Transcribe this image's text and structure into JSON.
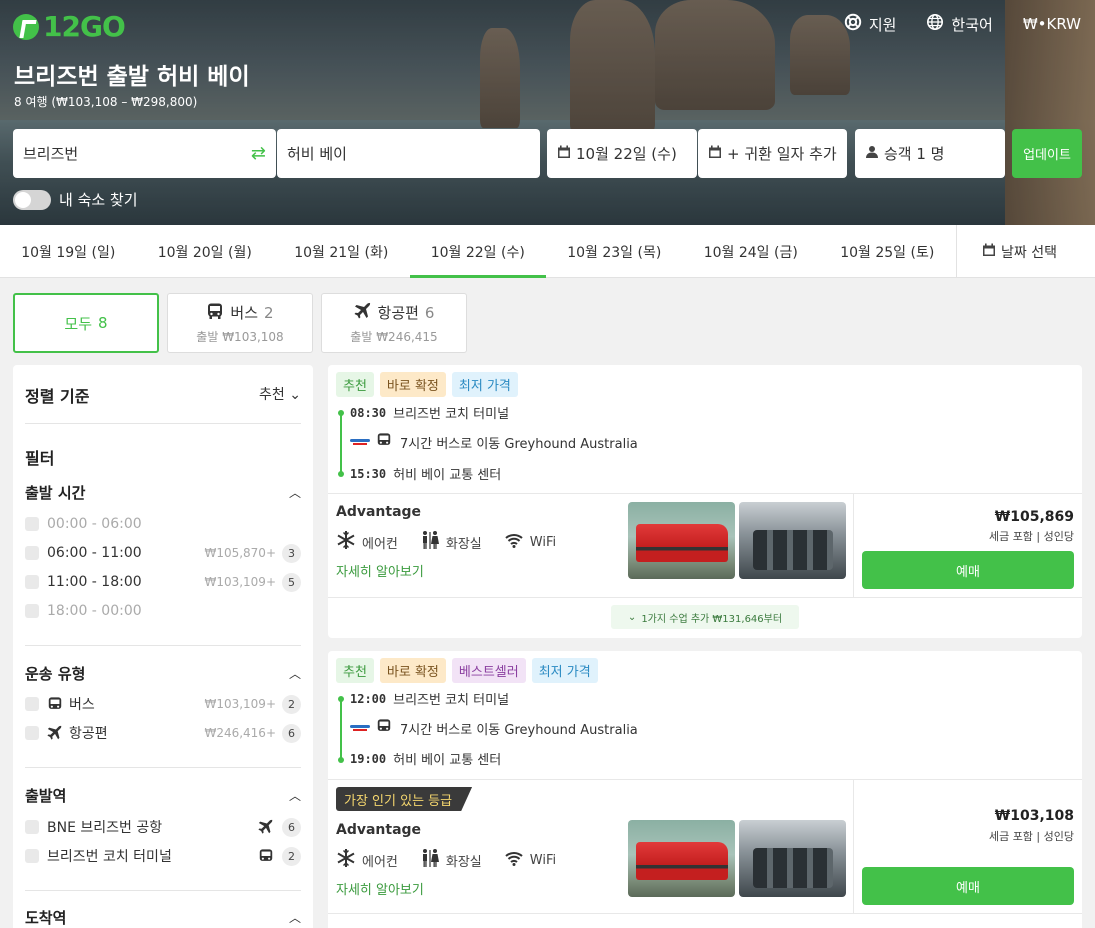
{
  "brand": {
    "name": "12GO",
    "accent": "#43c149"
  },
  "topnav": {
    "support": "지원",
    "language": "한국어",
    "currency": "₩•KRW"
  },
  "header": {
    "title": "브리즈번 출발 허비 베이",
    "subtitle": "8 여행 (₩103,108 – ₩298,800)"
  },
  "search": {
    "from": "브리즈번",
    "to": "허비 베이",
    "date": "10월 22일 (수)",
    "return": "+ 귀환 일자 추가",
    "passengers": "승객 1 명",
    "update": "업데이트"
  },
  "toggle": {
    "label": "내 숙소 찾기",
    "on": false
  },
  "dates": [
    "10월 19일 (일)",
    "10월 20일 (월)",
    "10월 21일 (화)",
    "10월 22일 (수)",
    "10월 23일 (목)",
    "10월 24일 (금)",
    "10월 25일 (토)"
  ],
  "date_pick": "날짜 선택",
  "modes": {
    "all": {
      "label": "모두",
      "count": "8"
    },
    "bus": {
      "label": "버스",
      "count": "2",
      "sub": "출발 ₩103,108"
    },
    "flight": {
      "label": "항공편",
      "count": "6",
      "sub": "출발 ₩246,415"
    }
  },
  "sidebar": {
    "sort_label": "정렬 기준",
    "sort_value": "추천",
    "filters": "필터",
    "departure_time": {
      "title": "출발 시간",
      "options": [
        {
          "label": "00:00 - 06:00",
          "price": "",
          "count": "",
          "disabled": true
        },
        {
          "label": "06:00 - 11:00",
          "price": "₩105,870+",
          "count": "3",
          "disabled": false
        },
        {
          "label": "11:00 - 18:00",
          "price": "₩103,109+",
          "count": "5",
          "disabled": false
        },
        {
          "label": "18:00 - 00:00",
          "price": "",
          "count": "",
          "disabled": true
        }
      ]
    },
    "transport": {
      "title": "운송 유형",
      "options": [
        {
          "label": "버스",
          "price": "₩103,109+",
          "count": "2"
        },
        {
          "label": "항공편",
          "price": "₩246,416+",
          "count": "6"
        }
      ]
    },
    "from_station": {
      "title": "출발역",
      "options": [
        {
          "label": "BNE 브리즈번 공항",
          "count": "6"
        },
        {
          "label": "브리즈번 코치 터미널",
          "count": "2"
        }
      ]
    },
    "to_station": {
      "title": "도착역"
    }
  },
  "trips": [
    {
      "tags": [
        "추천",
        "바로 확정",
        "최저 가격"
      ],
      "dep_time": "08:30",
      "dep_station": "브리즈번 코치 터미널",
      "duration": "7시간 버스로 이동 Greyhound Australia",
      "arr_time": "15:30",
      "arr_station": "허비 베이 교통 센터",
      "class": "Advantage",
      "amenities": [
        "에어컨",
        "화장실",
        "WiFi"
      ],
      "more": "자세히 알아보기",
      "price": "₩105,869",
      "price_note": "세금 포함 | 성인당",
      "book": "예매",
      "extra": "1가지 수업 추가 ₩131,646부터"
    },
    {
      "tags": [
        "추천",
        "바로 확정",
        "베스트셀러",
        "최저 가격"
      ],
      "dep_time": "12:00",
      "dep_station": "브리즈번 코치 터미널",
      "duration": "7시간 버스로 이동 Greyhound Australia",
      "arr_time": "19:00",
      "arr_station": "허비 베이 교통 센터",
      "badge": "가장 인기 있는 등급",
      "class": "Advantage",
      "amenities": [
        "에어컨",
        "화장실",
        "WiFi"
      ],
      "more": "자세히 알아보기",
      "price": "₩103,108",
      "price_note": "세금 포함 | 성인당",
      "book": "예매"
    }
  ]
}
